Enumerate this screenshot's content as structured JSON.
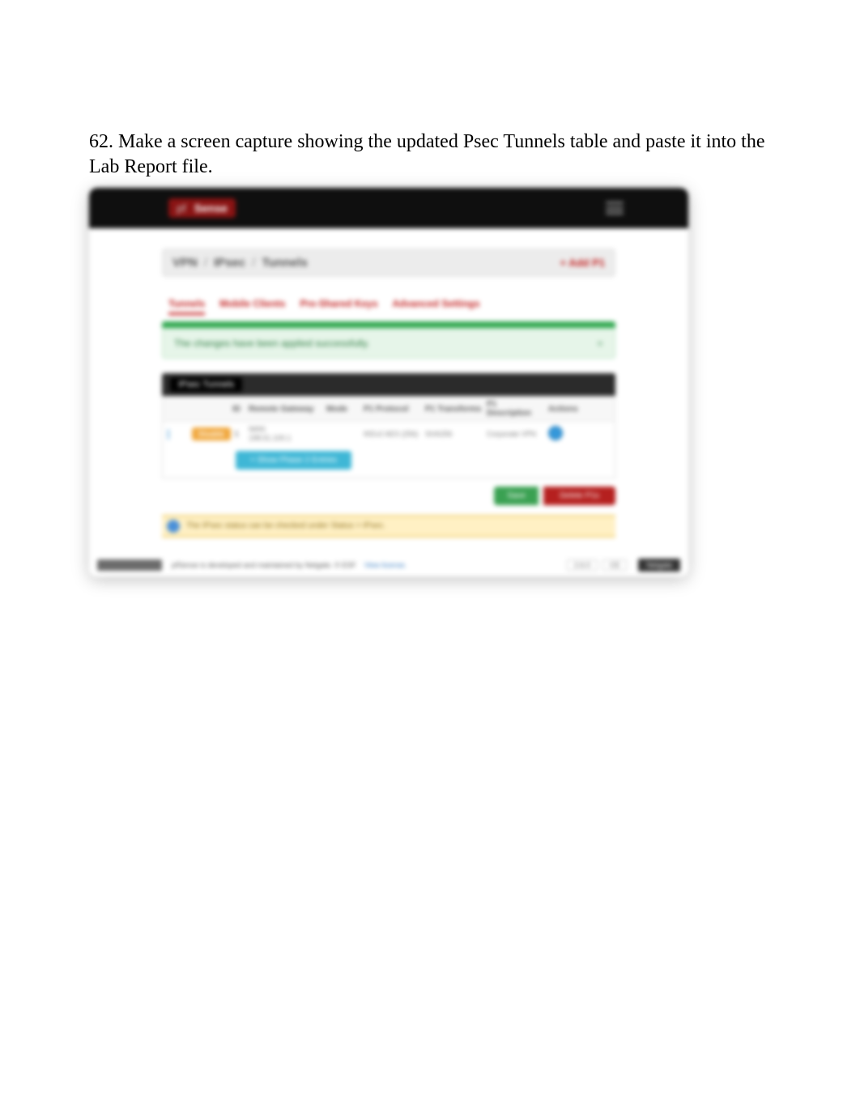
{
  "instruction": "62. Make a screen capture showing the updated Psec Tunnels table and paste it into the Lab Report file.",
  "topbar": {
    "logo_prefix": "pf",
    "logo_text": "Sense"
  },
  "breadcrumb": {
    "a": "VPN",
    "b": "IPsec",
    "c": "Tunnels",
    "action": "+ Add P1"
  },
  "tabs": {
    "t0": "Tunnels",
    "t1": "Mobile Clients",
    "t2": "Pre-Shared Keys",
    "t3": "Advanced Settings"
  },
  "success": {
    "msg": "The changes have been applied successfully.",
    "close": "×"
  },
  "section": {
    "header": "IPsec Tunnels"
  },
  "table": {
    "headers": {
      "id": "ID",
      "a": "Remote Gateway",
      "b": "Mode",
      "c": "P1 Protocol",
      "d": "P1 Transforms",
      "e": "P1 Description",
      "f": "Actions"
    },
    "row": {
      "edit": "Disable",
      "id": "1",
      "a_line1": "WAN",
      "a_line2": "198.51.100.1",
      "c": "IKEv2 AES (256)",
      "d": "SHA256",
      "e": "Corporate VPN"
    },
    "sub_btn": "+ Show Phase 2 Entries"
  },
  "actions": {
    "save": "Save",
    "delete": "Delete P1s"
  },
  "warn": "The IPsec status can be checked under Status > IPsec.",
  "footer": {
    "left": "pfSense is developed and maintained by Netgate. © ESF",
    "link": "View license.",
    "box1": "2.6.0",
    "box2": "CE",
    "dark": "Netgate"
  }
}
